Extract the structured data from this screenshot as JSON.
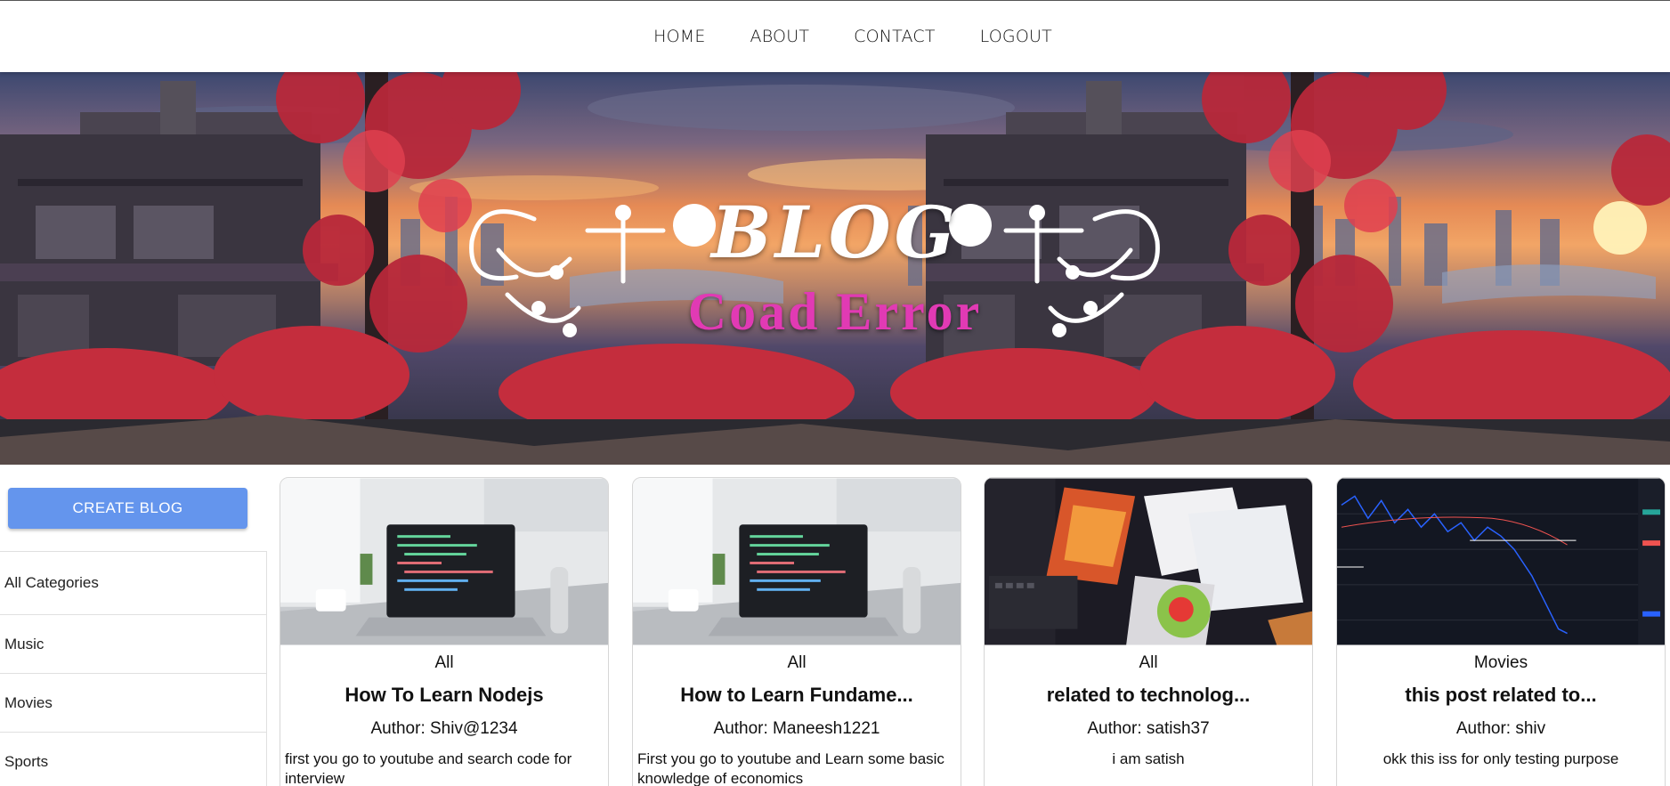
{
  "nav": {
    "items": [
      "HOME",
      "ABOUT",
      "CONTACT",
      "LOGOUT"
    ]
  },
  "banner": {
    "title": "BLOG",
    "subtitle": "Coad Error"
  },
  "sidebar": {
    "create_button": "CREATE BLOG",
    "categories": [
      "All Categories",
      "Music",
      "Movies",
      "Sports"
    ]
  },
  "posts": [
    {
      "category": "All",
      "title": "How To Learn Nodejs",
      "author": "Author: Shiv@1234",
      "description": "first you go to youtube and search code for interview",
      "image_icon": "laptop-photo"
    },
    {
      "category": "All",
      "title": "How to Learn Fundame...",
      "author": "Author: Maneesh1221",
      "description": "First you go to youtube and Learn some basic knowledge of economics",
      "image_icon": "laptop-photo"
    },
    {
      "category": "All",
      "title": "related to technolog...",
      "author": "Author: satish37",
      "description": "i am satish",
      "image_icon": "desk-papers-photo"
    },
    {
      "category": "Movies",
      "title": "this post related to...",
      "author": "Author: shiv",
      "description": "okk this iss for only testing purpose",
      "image_icon": "stock-chart-photo"
    }
  ],
  "colors": {
    "accent": "#6495ed",
    "subtitle": "#e13ab4"
  }
}
